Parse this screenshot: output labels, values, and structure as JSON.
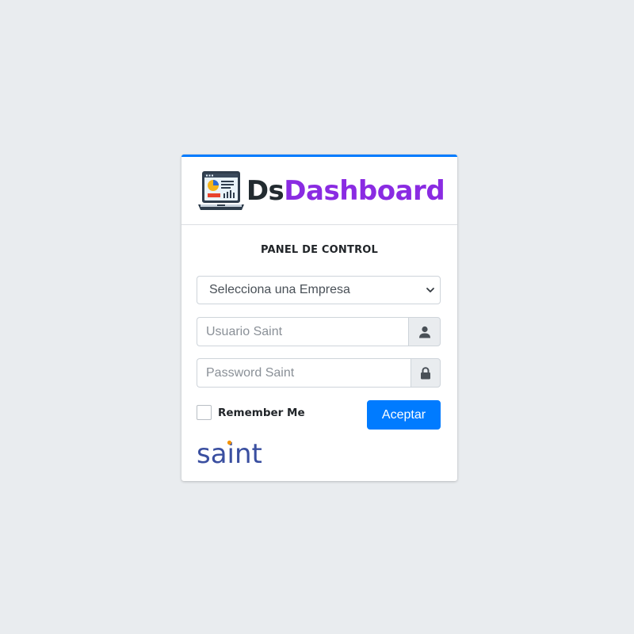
{
  "brand": {
    "prefix": "Ds",
    "suffix": "Dashboard",
    "prefix_color": "#222b30",
    "suffix_color": "#8a2be2",
    "icon": "laptop-dashboard-icon"
  },
  "panel": {
    "title": "PANEL DE CONTROL"
  },
  "company_select": {
    "selected": "Selecciona una Empresa",
    "icon": "chevron-down-icon"
  },
  "username": {
    "value": "",
    "placeholder": "Usuario Saint",
    "icon": "user-icon"
  },
  "password": {
    "value": "",
    "placeholder": "Password Saint",
    "icon": "lock-icon"
  },
  "remember": {
    "label": "Remember Me",
    "checked": false
  },
  "submit": {
    "label": "Aceptar"
  },
  "footer_logo": {
    "text": "saint",
    "color": "#3a4fa0",
    "dot_color": "#f39200"
  },
  "colors": {
    "accent": "#007bff",
    "background": "#e9ecef"
  }
}
